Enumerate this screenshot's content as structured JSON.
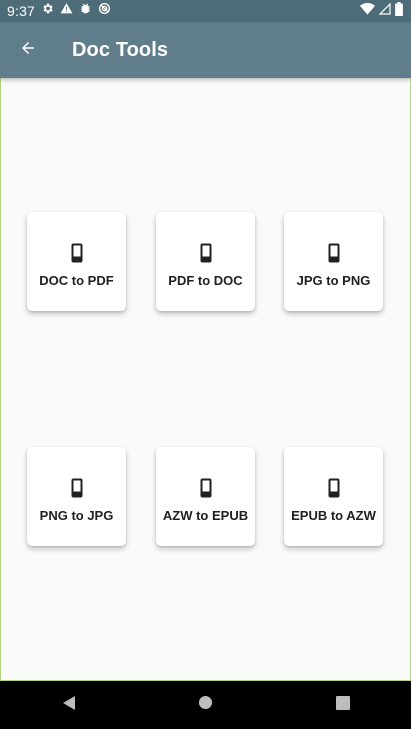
{
  "status_bar": {
    "time": "9:37",
    "left_icons": [
      "gear-icon",
      "warning-icon",
      "bug-icon",
      "sync-icon"
    ],
    "right_icons": [
      "wifi-icon",
      "signal-icon",
      "battery-icon"
    ]
  },
  "app_bar": {
    "title": "Doc Tools",
    "background": "#607d8b"
  },
  "tools": [
    {
      "label": "DOC to PDF",
      "icon": "phone-icon"
    },
    {
      "label": "PDF to DOC",
      "icon": "phone-icon"
    },
    {
      "label": "JPG to PNG",
      "icon": "phone-icon"
    },
    {
      "label": "PNG to JPG",
      "icon": "phone-icon"
    },
    {
      "label": "AZW to EPUB",
      "icon": "phone-icon"
    },
    {
      "label": "EPUB to AZW",
      "icon": "phone-icon"
    }
  ],
  "nav_bar": {
    "buttons": [
      "back-triangle-icon",
      "home-circle-icon",
      "recents-square-icon"
    ]
  }
}
